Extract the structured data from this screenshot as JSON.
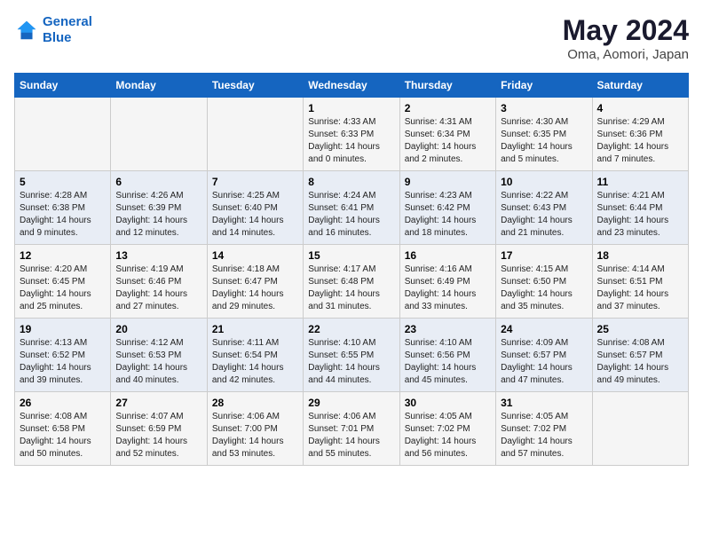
{
  "header": {
    "logo_line1": "General",
    "logo_line2": "Blue",
    "title": "May 2024",
    "subtitle": "Oma, Aomori, Japan"
  },
  "days_of_week": [
    "Sunday",
    "Monday",
    "Tuesday",
    "Wednesday",
    "Thursday",
    "Friday",
    "Saturday"
  ],
  "weeks": [
    [
      {
        "day": "",
        "content": ""
      },
      {
        "day": "",
        "content": ""
      },
      {
        "day": "",
        "content": ""
      },
      {
        "day": "1",
        "content": "Sunrise: 4:33 AM\nSunset: 6:33 PM\nDaylight: 14 hours\nand 0 minutes."
      },
      {
        "day": "2",
        "content": "Sunrise: 4:31 AM\nSunset: 6:34 PM\nDaylight: 14 hours\nand 2 minutes."
      },
      {
        "day": "3",
        "content": "Sunrise: 4:30 AM\nSunset: 6:35 PM\nDaylight: 14 hours\nand 5 minutes."
      },
      {
        "day": "4",
        "content": "Sunrise: 4:29 AM\nSunset: 6:36 PM\nDaylight: 14 hours\nand 7 minutes."
      }
    ],
    [
      {
        "day": "5",
        "content": "Sunrise: 4:28 AM\nSunset: 6:38 PM\nDaylight: 14 hours\nand 9 minutes."
      },
      {
        "day": "6",
        "content": "Sunrise: 4:26 AM\nSunset: 6:39 PM\nDaylight: 14 hours\nand 12 minutes."
      },
      {
        "day": "7",
        "content": "Sunrise: 4:25 AM\nSunset: 6:40 PM\nDaylight: 14 hours\nand 14 minutes."
      },
      {
        "day": "8",
        "content": "Sunrise: 4:24 AM\nSunset: 6:41 PM\nDaylight: 14 hours\nand 16 minutes."
      },
      {
        "day": "9",
        "content": "Sunrise: 4:23 AM\nSunset: 6:42 PM\nDaylight: 14 hours\nand 18 minutes."
      },
      {
        "day": "10",
        "content": "Sunrise: 4:22 AM\nSunset: 6:43 PM\nDaylight: 14 hours\nand 21 minutes."
      },
      {
        "day": "11",
        "content": "Sunrise: 4:21 AM\nSunset: 6:44 PM\nDaylight: 14 hours\nand 23 minutes."
      }
    ],
    [
      {
        "day": "12",
        "content": "Sunrise: 4:20 AM\nSunset: 6:45 PM\nDaylight: 14 hours\nand 25 minutes."
      },
      {
        "day": "13",
        "content": "Sunrise: 4:19 AM\nSunset: 6:46 PM\nDaylight: 14 hours\nand 27 minutes."
      },
      {
        "day": "14",
        "content": "Sunrise: 4:18 AM\nSunset: 6:47 PM\nDaylight: 14 hours\nand 29 minutes."
      },
      {
        "day": "15",
        "content": "Sunrise: 4:17 AM\nSunset: 6:48 PM\nDaylight: 14 hours\nand 31 minutes."
      },
      {
        "day": "16",
        "content": "Sunrise: 4:16 AM\nSunset: 6:49 PM\nDaylight: 14 hours\nand 33 minutes."
      },
      {
        "day": "17",
        "content": "Sunrise: 4:15 AM\nSunset: 6:50 PM\nDaylight: 14 hours\nand 35 minutes."
      },
      {
        "day": "18",
        "content": "Sunrise: 4:14 AM\nSunset: 6:51 PM\nDaylight: 14 hours\nand 37 minutes."
      }
    ],
    [
      {
        "day": "19",
        "content": "Sunrise: 4:13 AM\nSunset: 6:52 PM\nDaylight: 14 hours\nand 39 minutes."
      },
      {
        "day": "20",
        "content": "Sunrise: 4:12 AM\nSunset: 6:53 PM\nDaylight: 14 hours\nand 40 minutes."
      },
      {
        "day": "21",
        "content": "Sunrise: 4:11 AM\nSunset: 6:54 PM\nDaylight: 14 hours\nand 42 minutes."
      },
      {
        "day": "22",
        "content": "Sunrise: 4:10 AM\nSunset: 6:55 PM\nDaylight: 14 hours\nand 44 minutes."
      },
      {
        "day": "23",
        "content": "Sunrise: 4:10 AM\nSunset: 6:56 PM\nDaylight: 14 hours\nand 45 minutes."
      },
      {
        "day": "24",
        "content": "Sunrise: 4:09 AM\nSunset: 6:57 PM\nDaylight: 14 hours\nand 47 minutes."
      },
      {
        "day": "25",
        "content": "Sunrise: 4:08 AM\nSunset: 6:57 PM\nDaylight: 14 hours\nand 49 minutes."
      }
    ],
    [
      {
        "day": "26",
        "content": "Sunrise: 4:08 AM\nSunset: 6:58 PM\nDaylight: 14 hours\nand 50 minutes."
      },
      {
        "day": "27",
        "content": "Sunrise: 4:07 AM\nSunset: 6:59 PM\nDaylight: 14 hours\nand 52 minutes."
      },
      {
        "day": "28",
        "content": "Sunrise: 4:06 AM\nSunset: 7:00 PM\nDaylight: 14 hours\nand 53 minutes."
      },
      {
        "day": "29",
        "content": "Sunrise: 4:06 AM\nSunset: 7:01 PM\nDaylight: 14 hours\nand 55 minutes."
      },
      {
        "day": "30",
        "content": "Sunrise: 4:05 AM\nSunset: 7:02 PM\nDaylight: 14 hours\nand 56 minutes."
      },
      {
        "day": "31",
        "content": "Sunrise: 4:05 AM\nSunset: 7:02 PM\nDaylight: 14 hours\nand 57 minutes."
      },
      {
        "day": "",
        "content": ""
      }
    ]
  ]
}
